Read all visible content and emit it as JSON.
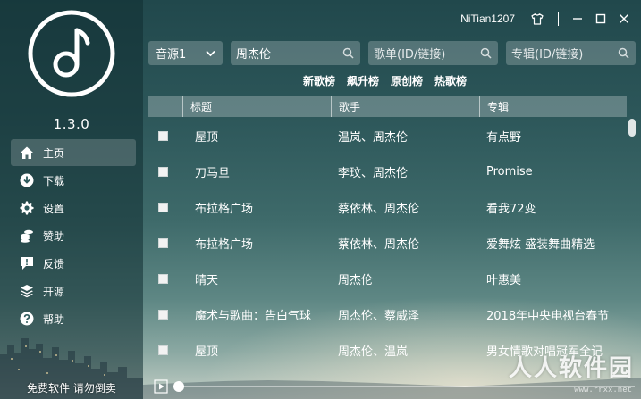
{
  "app": {
    "version": "1.3.0",
    "username": "NiTian1207"
  },
  "sidebar": {
    "items": [
      {
        "label": "主页",
        "icon": "home-icon",
        "active": true
      },
      {
        "label": "下载",
        "icon": "download-icon",
        "active": false
      },
      {
        "label": "设置",
        "icon": "gear-icon",
        "active": false
      },
      {
        "label": "赞助",
        "icon": "coins-icon",
        "active": false
      },
      {
        "label": "反馈",
        "icon": "feedback-icon",
        "active": false
      },
      {
        "label": "开源",
        "icon": "layers-icon",
        "active": false
      },
      {
        "label": "帮助",
        "icon": "help-icon",
        "active": false
      }
    ]
  },
  "search": {
    "source_selected": "音源1",
    "song_query": "周杰伦",
    "playlist_placeholder": "歌单(ID/链接)",
    "album_placeholder": "专辑(ID/链接)"
  },
  "charts": [
    "新歌榜",
    "飙升榜",
    "原创榜",
    "热歌榜"
  ],
  "table": {
    "headers": {
      "title": "标题",
      "artist": "歌手",
      "album": "专辑"
    },
    "rows": [
      {
        "title": "屋顶",
        "artist": "温岚、周杰伦",
        "album": "有点野"
      },
      {
        "title": "刀马旦",
        "artist": "李玟、周杰伦",
        "album": "Promise"
      },
      {
        "title": "布拉格广场",
        "artist": "蔡依林、周杰伦",
        "album": "看我72变"
      },
      {
        "title": "布拉格广场",
        "artist": "蔡依林、周杰伦",
        "album": "爱舞炫 盛装舞曲精选"
      },
      {
        "title": "晴天",
        "artist": "周杰伦",
        "album": "叶惠美"
      },
      {
        "title": "魔术与歌曲：告白气球",
        "artist": "周杰伦、蔡威泽",
        "album": "2018年中央电视台春节"
      },
      {
        "title": "屋顶",
        "artist": "周杰伦、温岚",
        "album": "男女情歌对唱冠军全记"
      }
    ]
  },
  "player": {
    "progress": 0.0
  },
  "footer": {
    "note": "免费软件 请勿倒卖"
  },
  "watermark": {
    "text": "人人软件园",
    "url": "www.rrxx.net"
  },
  "colors": {
    "accent": "#ffffff",
    "background_top": "#21484c",
    "background_bottom": "#c4cfc6"
  }
}
